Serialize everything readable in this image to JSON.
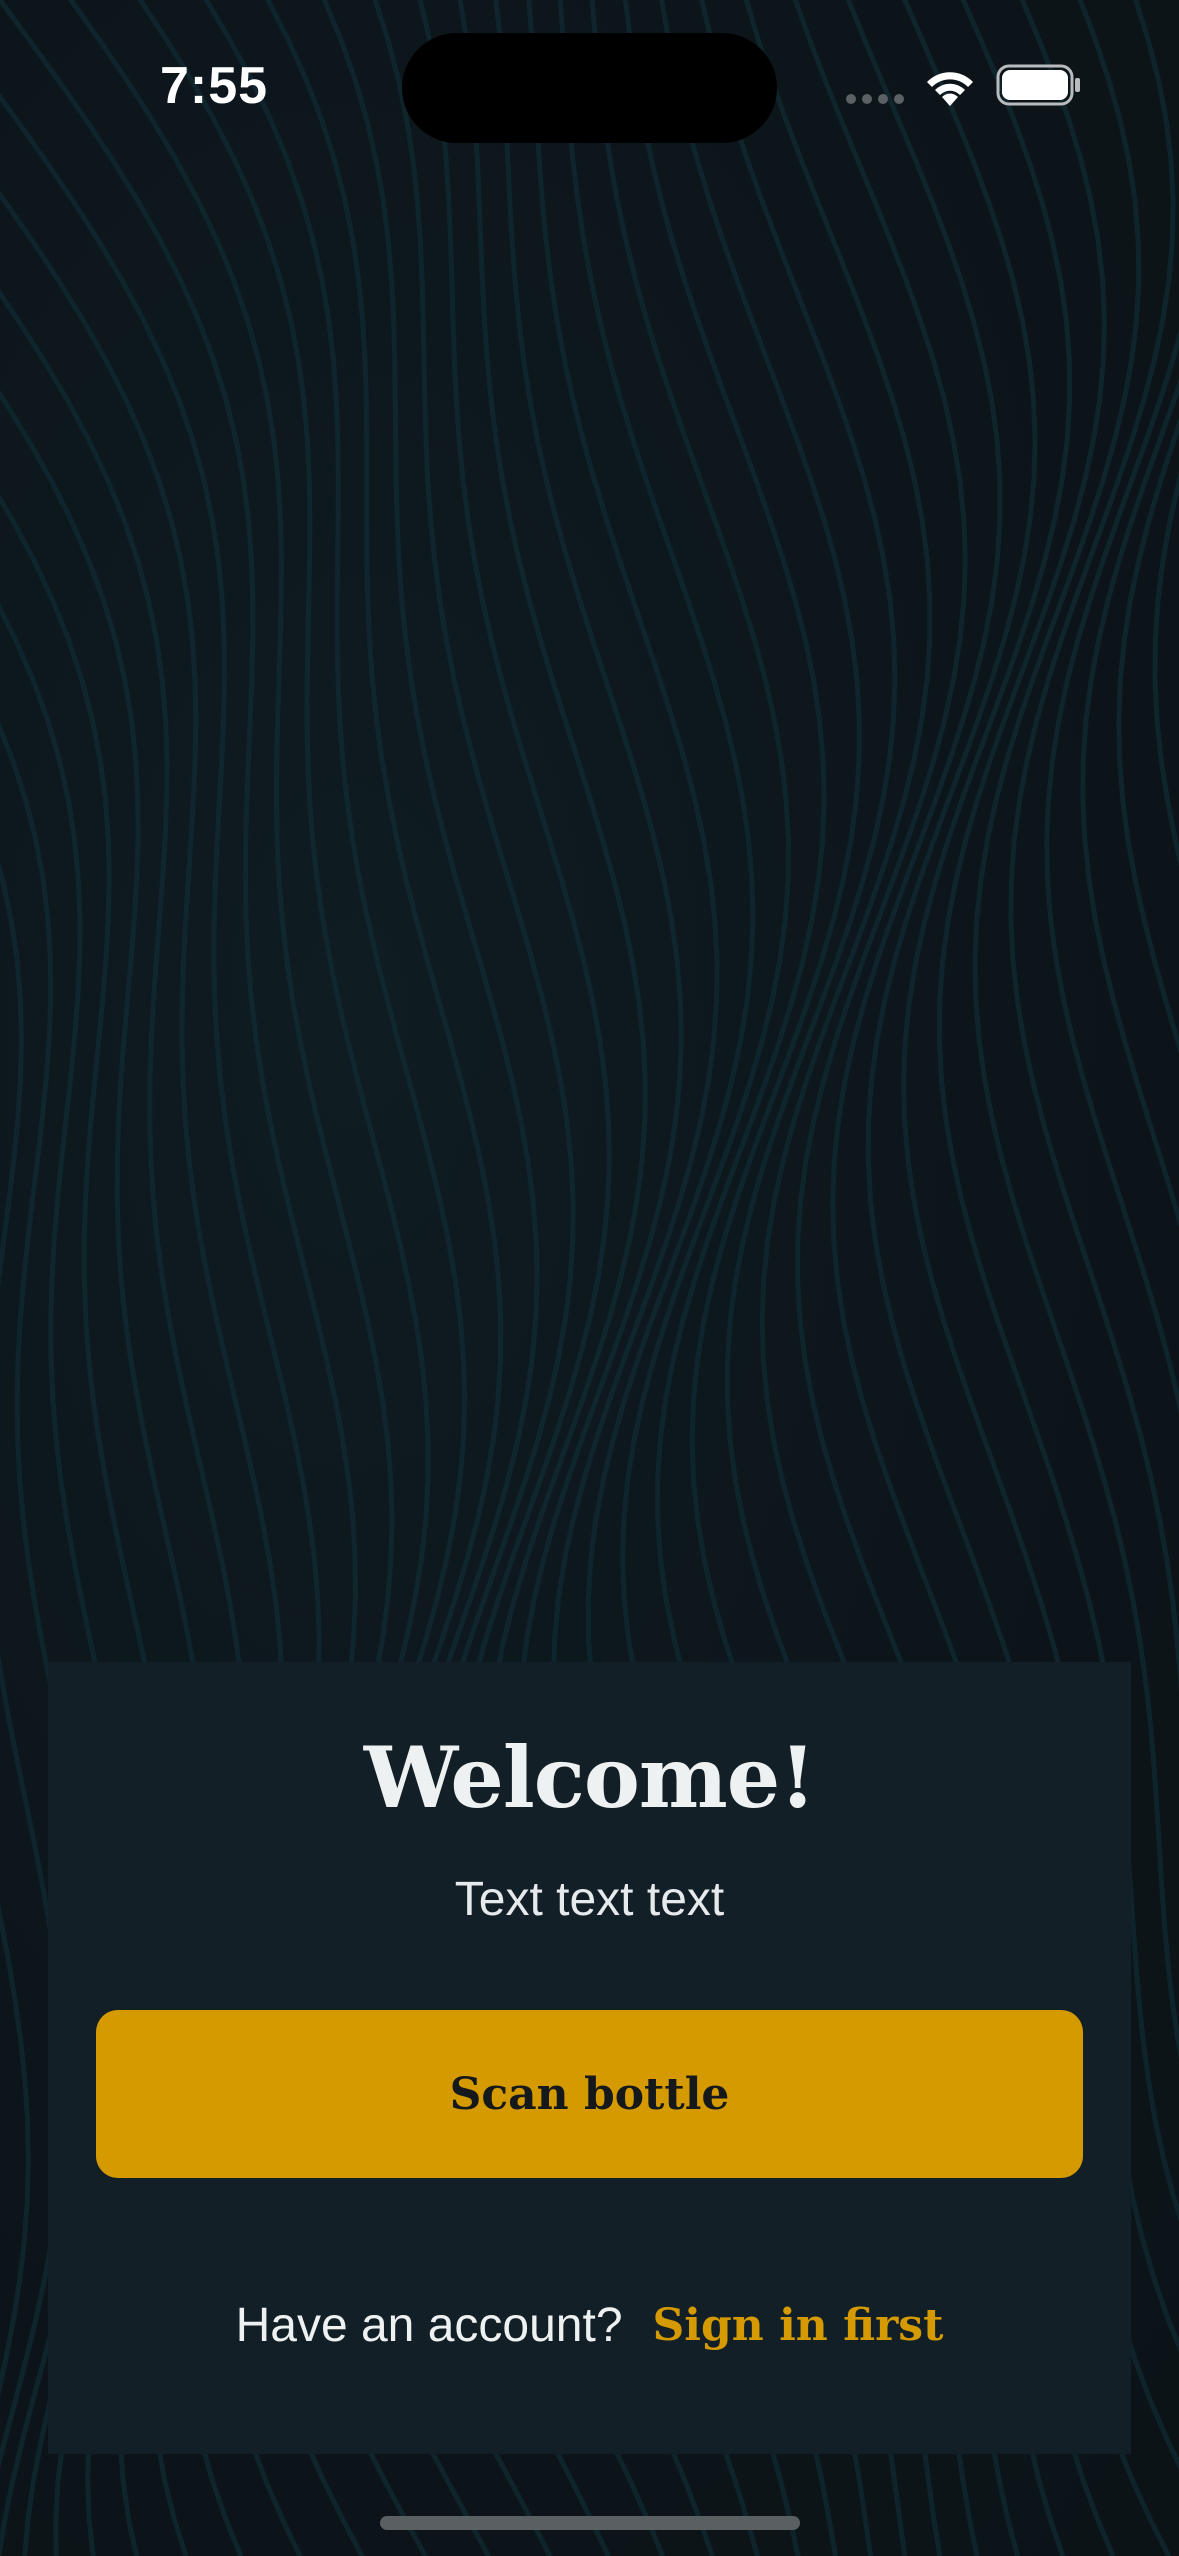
{
  "status_bar": {
    "time": "7:55"
  },
  "welcome": {
    "title": "Welcome!",
    "subtitle": "Text text text",
    "scan_button_label": "Scan bottle",
    "account_question": "Have an account?",
    "signin_label": "Sign in first"
  },
  "colors": {
    "background": "#0d1519",
    "card": "#121f26",
    "accent": "#d49a00",
    "text": "#eef1f2"
  }
}
